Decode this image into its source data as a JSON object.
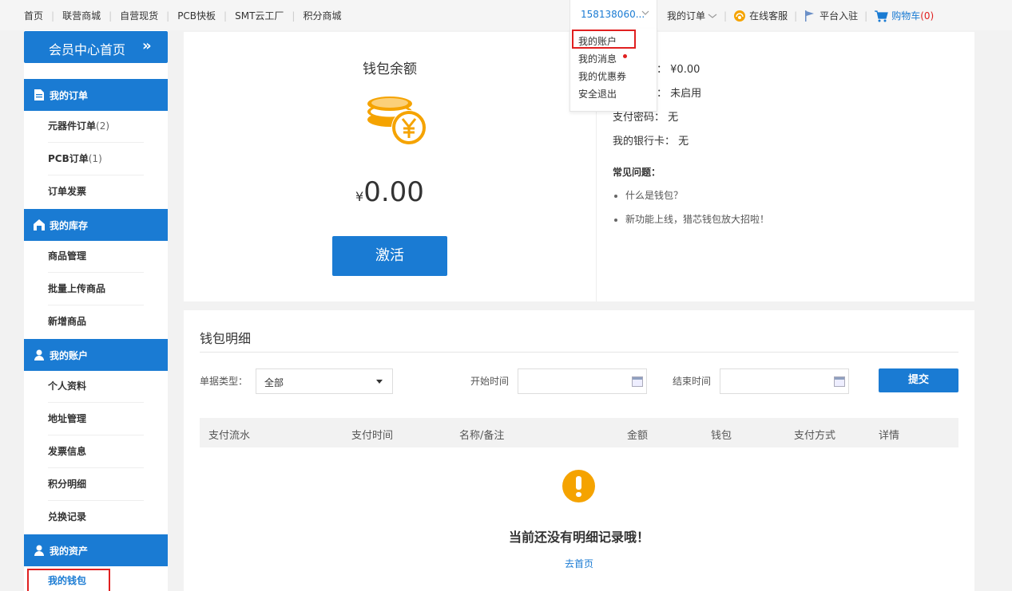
{
  "topnav": {
    "links": [
      "首页",
      "联营商城",
      "自营现货",
      "PCB快板",
      "SMT云工厂",
      "积分商城"
    ]
  },
  "user": {
    "name": "158138060...",
    "menu": [
      "我的账户",
      "我的消息",
      "我的优惠券",
      "安全退出"
    ]
  },
  "right_links": {
    "orders": "我的订单",
    "service": "在线客服",
    "platform": "平台入驻",
    "cart": "购物车",
    "cart_count": "(0)"
  },
  "sidebar": {
    "home": "会员中心首页",
    "sections": [
      {
        "title": "我的订单",
        "icon": "document-icon",
        "items": [
          {
            "label": "元器件订单",
            "count": "(2)"
          },
          {
            "label": "PCB订单",
            "count": "(1)"
          },
          {
            "label": "订单发票",
            "count": ""
          }
        ]
      },
      {
        "title": "我的库存",
        "icon": "warehouse-icon",
        "items": [
          {
            "label": "商品管理"
          },
          {
            "label": "批量上传商品"
          },
          {
            "label": "新增商品"
          }
        ]
      },
      {
        "title": "我的账户",
        "icon": "user-icon",
        "items": [
          {
            "label": "个人资料"
          },
          {
            "label": "地址管理"
          },
          {
            "label": "发票信息"
          },
          {
            "label": "积分明细"
          },
          {
            "label": "兑换记录"
          }
        ]
      },
      {
        "title": "我的资产",
        "icon": "user-icon",
        "items": [
          {
            "label": "我的钱包"
          }
        ]
      }
    ]
  },
  "wallet": {
    "title": "钱包余额",
    "currency": "¥",
    "amount": "0.00",
    "activate_label": "激活",
    "info": [
      {
        "label": "：",
        "value": "¥0.00"
      },
      {
        "label": "：",
        "value": "未启用"
      },
      {
        "label": "支付密码：",
        "value": "无"
      },
      {
        "label": "我的银行卡：",
        "value": "无"
      }
    ],
    "faq_title": "常见问题：",
    "faq": [
      "什么是钱包？",
      "新功能上线，猎芯钱包放大招啦！"
    ]
  },
  "detail": {
    "title": "钱包明细",
    "type_label": "单据类型：",
    "type_value": "全部",
    "start_label": "开始时间",
    "end_label": "结束时间",
    "submit_label": "提交",
    "columns": [
      "支付流水",
      "支付时间",
      "名称/备注",
      "金额",
      "钱包",
      "支付方式",
      "详情"
    ],
    "empty_text": "当前还没有明细记录哦！",
    "empty_link": "去首页"
  },
  "colors": {
    "primary": "#1a7bd3",
    "alert": "#e02020",
    "coin": "#f5a300"
  }
}
